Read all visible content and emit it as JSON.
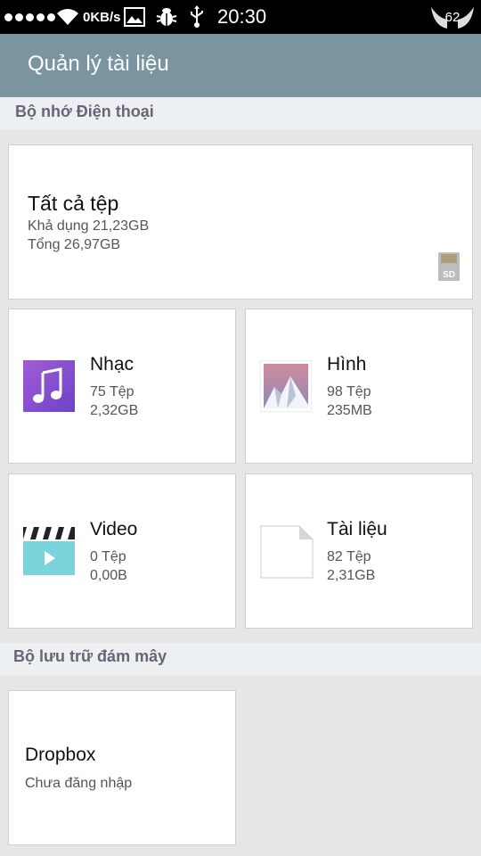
{
  "status_bar": {
    "net_speed": "0KB/s",
    "time": "20:30",
    "badge": "62"
  },
  "header": {
    "title": "Quản lý tài liệu"
  },
  "phone_storage": {
    "section_label": "Bộ nhớ Điện thoại",
    "all_files": {
      "title": "Tất cả tệp",
      "available": "Khả dụng 21,23GB",
      "total": "Tổng 26,97GB"
    },
    "tiles": [
      {
        "title": "Nhạc",
        "count": "75 Tệp",
        "size": "2,32GB",
        "icon": "music-note-icon"
      },
      {
        "title": "Hình",
        "count": "98 Tệp",
        "size": "235MB",
        "icon": "mountain-image-icon"
      },
      {
        "title": "Video",
        "count": "0 Tệp",
        "size": "0,00B",
        "icon": "clapperboard-icon"
      },
      {
        "title": "Tài liệu",
        "count": "82 Tệp",
        "size": "2,31GB",
        "icon": "document-icon"
      }
    ]
  },
  "cloud_storage": {
    "section_label": "Bộ lưu trữ đám mây",
    "dropbox": {
      "title": "Dropbox",
      "status": "Chưa đăng nhập"
    }
  }
}
